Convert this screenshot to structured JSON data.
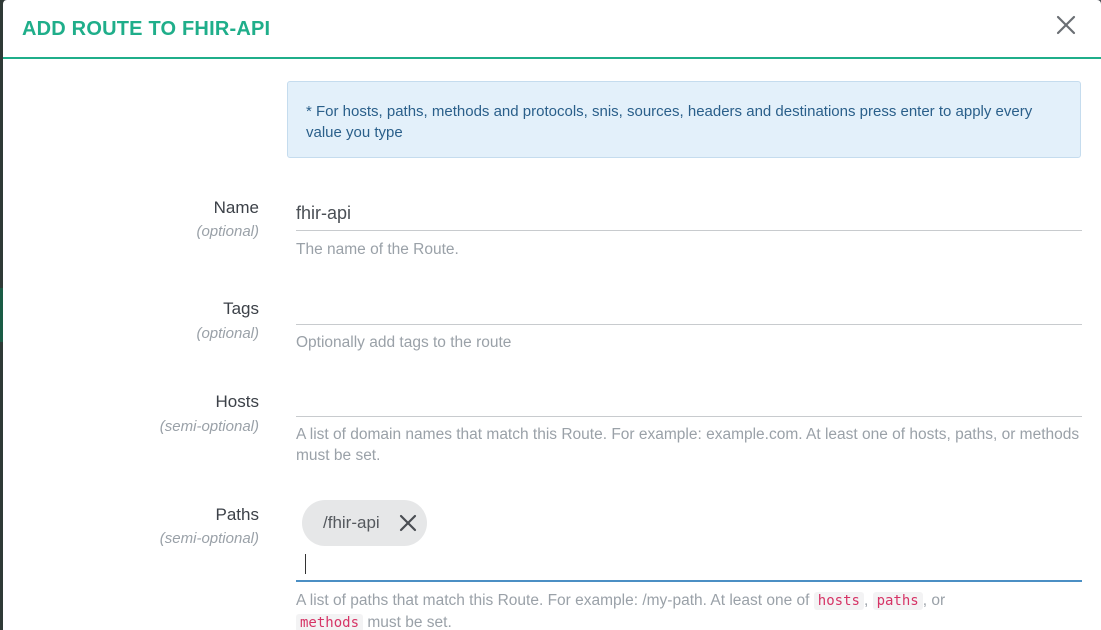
{
  "modal": {
    "title": "ADD ROUTE TO FHIR-API"
  },
  "info": {
    "text": "* For hosts, paths, methods and protocols, snis, sources, headers and destinations press enter to apply every value you type"
  },
  "fields": {
    "name": {
      "label": "Name",
      "sub": "(optional)",
      "value": "fhir-api",
      "help": "The name of the Route."
    },
    "tags": {
      "label": "Tags",
      "sub": "(optional)",
      "value": "",
      "help": "Optionally add tags to the route"
    },
    "hosts": {
      "label": "Hosts",
      "sub": "(semi-optional)",
      "value": "",
      "help": "A list of domain names that match this Route. For example: example.com. At least one of hosts, paths, or methods must be set."
    },
    "paths": {
      "label": "Paths",
      "sub": "(semi-optional)",
      "chips": [
        "/fhir-api"
      ],
      "help_prefix": "A list of paths that match this Route. For example: /my-path. At least one of",
      "code1": "hosts",
      "sep1": ",",
      "code2": "paths",
      "sep2": ", or",
      "code3": "methods",
      "help_suffix": "must be set."
    }
  },
  "icons": {
    "close": "close-icon",
    "chip_remove": "close-icon"
  },
  "colors": {
    "accent": "#1fae8a",
    "info_bg": "#e3f0fa",
    "info_text": "#2a5f8a",
    "code": "#d63466",
    "focus": "#4b8fc4"
  }
}
